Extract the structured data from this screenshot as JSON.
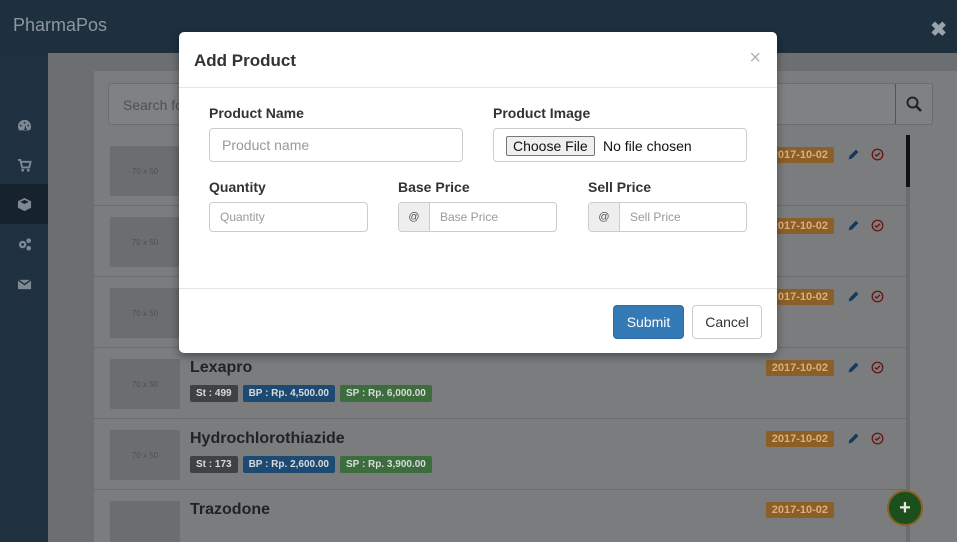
{
  "app": {
    "title": "PharmaPos"
  },
  "sidebar": {
    "items": [
      {
        "icon": "dashboard-icon"
      },
      {
        "icon": "cart-icon"
      },
      {
        "icon": "box-icon"
      },
      {
        "icon": "cogs-icon"
      },
      {
        "icon": "envelope-icon"
      }
    ]
  },
  "search": {
    "placeholder": "Search fo"
  },
  "products": [
    {
      "name": "",
      "thumb": "70 x 50",
      "date": "2017-10-02"
    },
    {
      "name": "",
      "thumb": "70 x 50",
      "date": "2017-10-02"
    },
    {
      "name": "",
      "thumb": "70 x 50",
      "date": "2017-10-02"
    },
    {
      "name": "Lexapro",
      "thumb": "70 x 50",
      "stock": "St : 499",
      "bp": "BP : Rp. 4,500.00",
      "sp": "SP : Rp. 6,000.00",
      "date": "2017-10-02"
    },
    {
      "name": "Hydrochlorothiazide",
      "thumb": "70 x 50",
      "stock": "St : 173",
      "bp": "BP : Rp. 2,600.00",
      "sp": "SP : Rp. 3,900.00",
      "date": "2017-10-02"
    },
    {
      "name": "Trazodone",
      "thumb": "",
      "date": "2017-10-02"
    }
  ],
  "modal": {
    "title": "Add Product",
    "close": "×",
    "product_name_label": "Product Name",
    "product_name_placeholder": "Product name",
    "product_image_label": "Product Image",
    "choose_file": "Choose File",
    "no_file": "No file chosen",
    "quantity_label": "Quantity",
    "quantity_placeholder": "Quantity",
    "base_price_label": "Base Price",
    "base_price_placeholder": "Base Price",
    "sell_price_label": "Sell Price",
    "sell_price_placeholder": "Sell Price",
    "addon": "@",
    "submit": "Submit",
    "cancel": "Cancel"
  },
  "fab": {
    "label": "+"
  },
  "colors": {
    "primary": "#337ab7",
    "date_badge": "#f0a030",
    "success": "#5cb85c"
  }
}
